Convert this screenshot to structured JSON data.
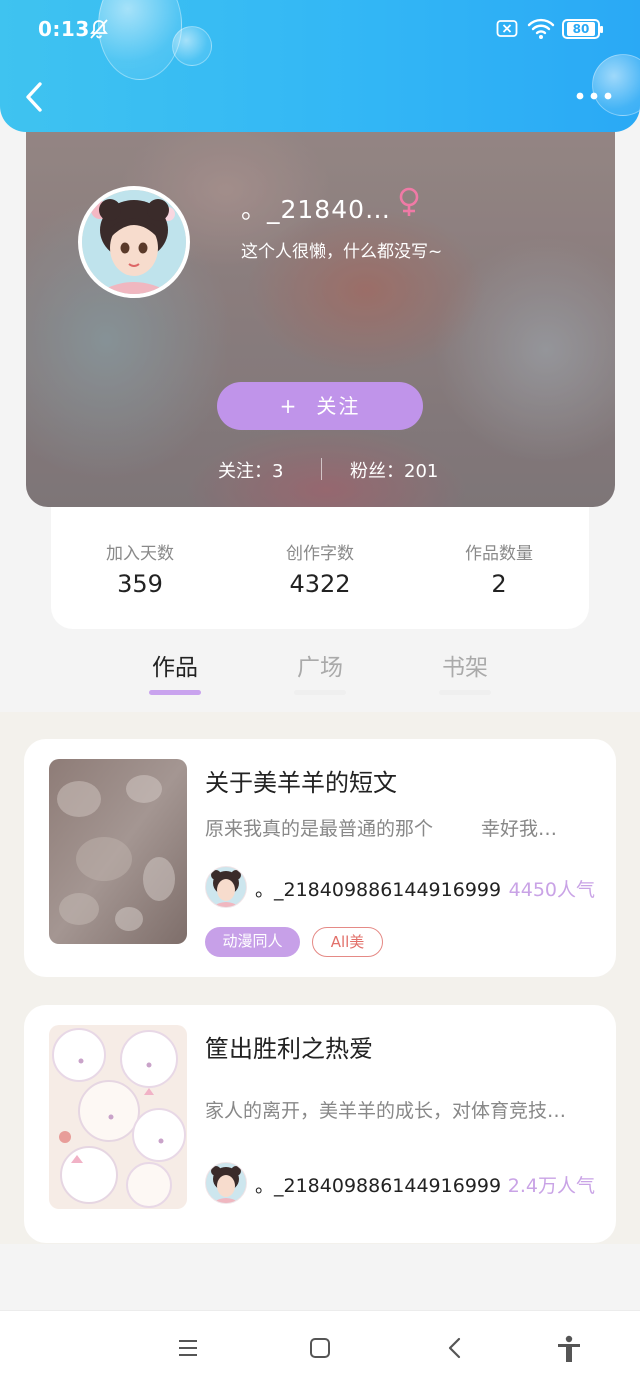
{
  "status_bar": {
    "time": "0:13",
    "battery": "80",
    "icons": [
      "bell-off-icon",
      "no-sim-icon",
      "wifi-icon",
      "battery-icon"
    ]
  },
  "header": {
    "back_icon": "chevron-left-icon",
    "more_icon": "more-dots-icon",
    "color": "#33b7f5"
  },
  "profile": {
    "username": "。_21840…",
    "gender_icon": "female-icon",
    "bio": "这个人很懒，什么都没写~",
    "follow_plus": "+",
    "follow_label": "关注",
    "following_label": "关注：3",
    "followers_label": "粉丝：201"
  },
  "stats": [
    {
      "label": "加入天数",
      "value": "359"
    },
    {
      "label": "创作字数",
      "value": "4322"
    },
    {
      "label": "作品数量",
      "value": "2"
    }
  ],
  "tabs": [
    {
      "label": "作品",
      "active": true
    },
    {
      "label": "广场",
      "active": false
    },
    {
      "label": "书架",
      "active": false
    }
  ],
  "works": [
    {
      "title": "关于美羊羊的短文",
      "desc_a": "原来我真的是最普通的那个",
      "desc_b": "幸好我…",
      "author": "。_218409886144916999",
      "popularity": "4450人气",
      "tags": [
        "动漫同人",
        "All美"
      ]
    },
    {
      "title": "筐出胜利之热爱",
      "desc_a": "家人的离开，美羊羊的成长，对体育竞技…",
      "desc_b": "",
      "author": "。_218409886144916999",
      "popularity": "2.4万人气",
      "tags": []
    }
  ],
  "colors": {
    "accent_purple": "#c094ea",
    "tag_outline": "#e2706a",
    "popularity": "#c9a3e6"
  },
  "nav_icons": [
    "menu-icon",
    "home-square-icon",
    "back-triangle-icon",
    "accessibility-icon"
  ]
}
